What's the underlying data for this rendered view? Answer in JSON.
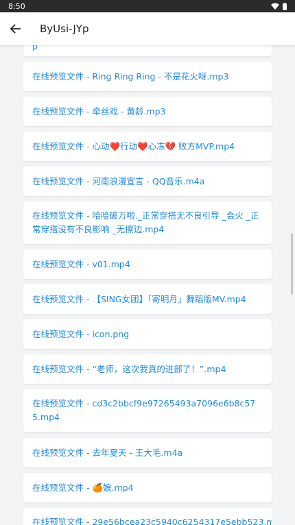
{
  "status_bar": {
    "time": "8:50"
  },
  "app_bar": {
    "title": "ByUsi-JYp"
  },
  "list": {
    "items": [
      {
        "label": "p"
      },
      {
        "label": "在线预览文件 - Ring Ring Ring - 不是花火呀.mp3"
      },
      {
        "label": "在线预览文件 - 牵丝戏 - 黄龄.mp3"
      },
      {
        "label": "在线预览文件 - 心动❤️行动❤️心冻💔 败方MVP.mp4"
      },
      {
        "label": "在线预览文件 - 河南浪漫宣言 - QQ音乐.m4a"
      },
      {
        "label": "在线预览文件 - 哈哈破万啦._正常穿搭无不良引导 _会火 _正常穿搭没有不良影响 _无擦边.mp4"
      },
      {
        "label": "在线预览文件 - v01.mp4"
      },
      {
        "label": "在线预览文件 - 【SING女团】「寄明月」舞蹈版MV.mp4"
      },
      {
        "label": "在线预览文件 - icon.png"
      },
      {
        "label": "在线预览文件 - “老师，这次我真的进部了！”.mp4"
      },
      {
        "label": "在线预览文件 - cd3c2bbcf9e97265493a7096e6b8c575.mp4"
      },
      {
        "label": "在线预览文件 - 去年夏天 - 王大毛.m4a"
      },
      {
        "label": "在线预览文件 - 🍊娘.mp4"
      },
      {
        "label": "在线预览文件 - 29e56bcea23c5940c6254317e5ebb523.m"
      }
    ]
  }
}
